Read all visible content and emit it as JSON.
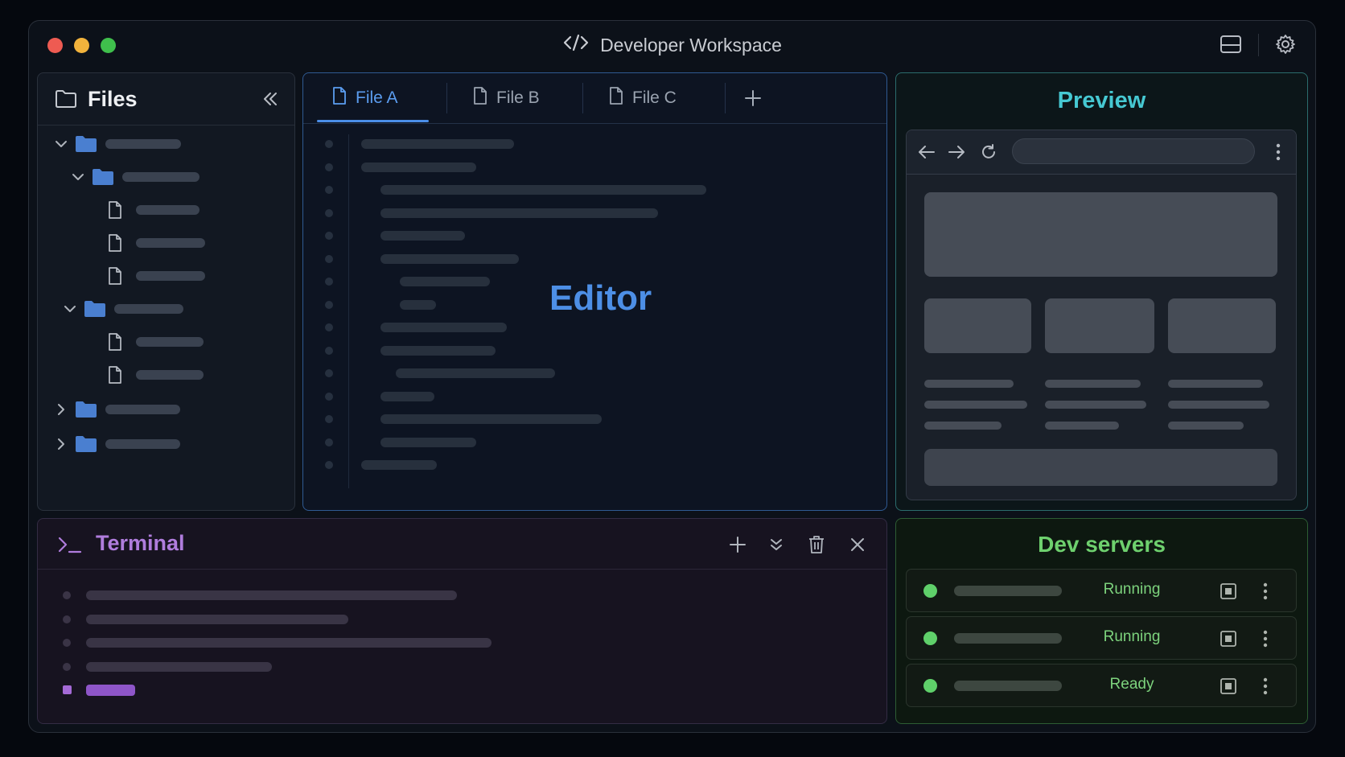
{
  "window": {
    "title": "Developer Workspace",
    "traffic_lights": [
      "#ee5b52",
      "#f2b33c",
      "#3fbf4c"
    ],
    "icons": [
      "code-icon",
      "layout-icon",
      "settings-gear-icon"
    ]
  },
  "files": {
    "title": "Files",
    "icons": [
      "folder-icon",
      "collapse-double-chevron-icon"
    ],
    "tree": [
      {
        "type": "folder",
        "state": "expanded",
        "depth": 0
      },
      {
        "type": "folder",
        "state": "expanded",
        "depth": 1
      },
      {
        "type": "file",
        "depth": 2
      },
      {
        "type": "file",
        "depth": 2
      },
      {
        "type": "file",
        "depth": 2
      },
      {
        "type": "folder",
        "state": "expanded",
        "depth": 1
      },
      {
        "type": "file",
        "depth": 2
      },
      {
        "type": "file",
        "depth": 2
      },
      {
        "type": "folder",
        "state": "collapsed",
        "depth": 0
      },
      {
        "type": "folder",
        "state": "collapsed",
        "depth": 0
      }
    ]
  },
  "editor": {
    "label": "Editor",
    "tabs": [
      {
        "label": "File A",
        "active": true
      },
      {
        "label": "File B",
        "active": false
      },
      {
        "label": "File C",
        "active": false
      }
    ],
    "new_tab_icon": "plus-icon",
    "accent": "#4b8ee8"
  },
  "preview": {
    "title": "Preview",
    "accent": "#46c8d2",
    "browser_icons": [
      "back-arrow-icon",
      "forward-arrow-icon",
      "reload-icon",
      "more-vertical-icon"
    ]
  },
  "terminal": {
    "title": "Terminal",
    "accent": "#b07ddd",
    "actions": [
      "plus-icon",
      "split-chevron-icon",
      "trash-icon",
      "close-icon"
    ]
  },
  "dev_servers": {
    "title": "Dev servers",
    "accent": "#6ed06e",
    "servers": [
      {
        "status": "Running"
      },
      {
        "status": "Running"
      },
      {
        "status": "Ready"
      }
    ]
  }
}
